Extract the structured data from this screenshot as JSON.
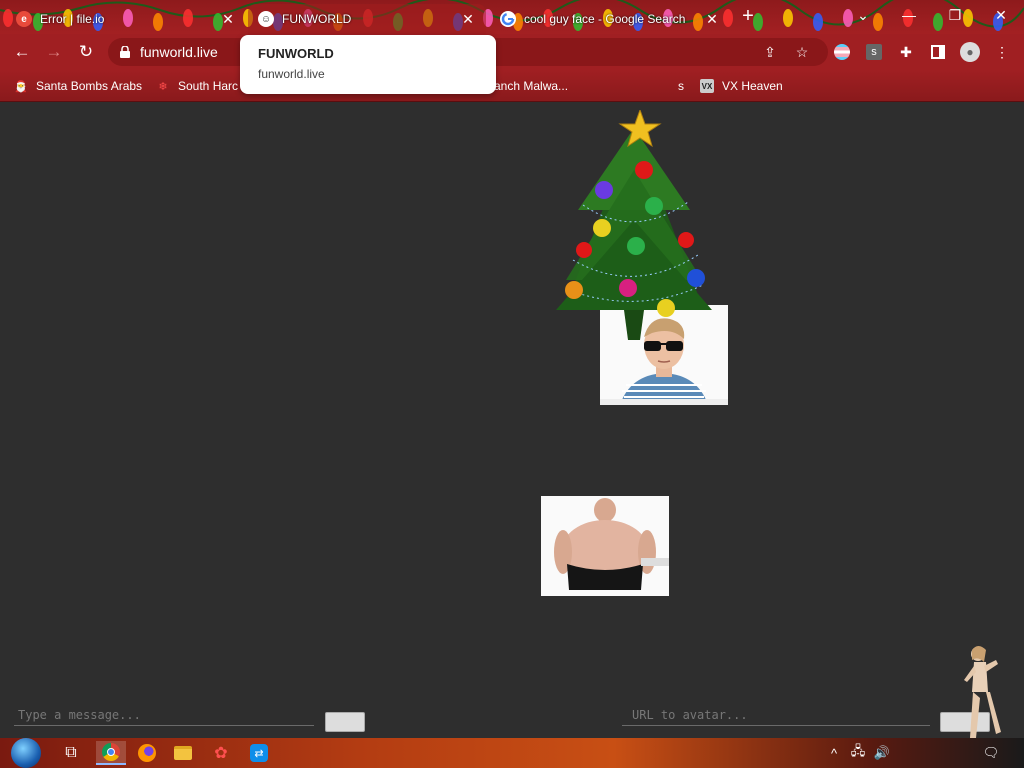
{
  "browser": {
    "tabs": [
      {
        "title": "Error | file.io",
        "favicon_icon": "file-io-icon",
        "active": false
      },
      {
        "title": "FUNWORLD",
        "favicon_icon": "funworld-icon",
        "active": true
      },
      {
        "title": "cool guy face - Google Search",
        "favicon_icon": "google-icon",
        "active": false
      }
    ],
    "new_tab_symbol": "+",
    "address": "funworld.live",
    "bookmarks": [
      {
        "label": "Santa Bombs Arabs",
        "icon": "santa-icon"
      },
      {
        "label": "South Harc",
        "icon": "snowflake-icon"
      },
      {
        "label": "anch Malwa...",
        "icon": "folder-icon"
      },
      {
        "label": "s",
        "icon": "folder-icon"
      },
      {
        "label": "VX Heaven",
        "icon": "vx-heaven-icon"
      }
    ]
  },
  "tooltip": {
    "title": "FUNWORLD",
    "url": "funworld.live"
  },
  "page": {
    "message_placeholder": "Type a message...",
    "send_label": "",
    "avatar_placeholder": "URL to avatar...",
    "set_label": "",
    "images": [
      {
        "name": "christmas-tree",
        "description_icon": "christmas-tree-icon"
      },
      {
        "name": "cool-guy-photo",
        "description_icon": "photo-icon"
      },
      {
        "name": "shirtless-man-photo",
        "description_icon": "photo-icon"
      },
      {
        "name": "dancing-figure",
        "description_icon": "dancer-icon"
      }
    ]
  },
  "colors": {
    "chrome_red": "#a01f22",
    "page_bg": "#2e2e2e"
  }
}
